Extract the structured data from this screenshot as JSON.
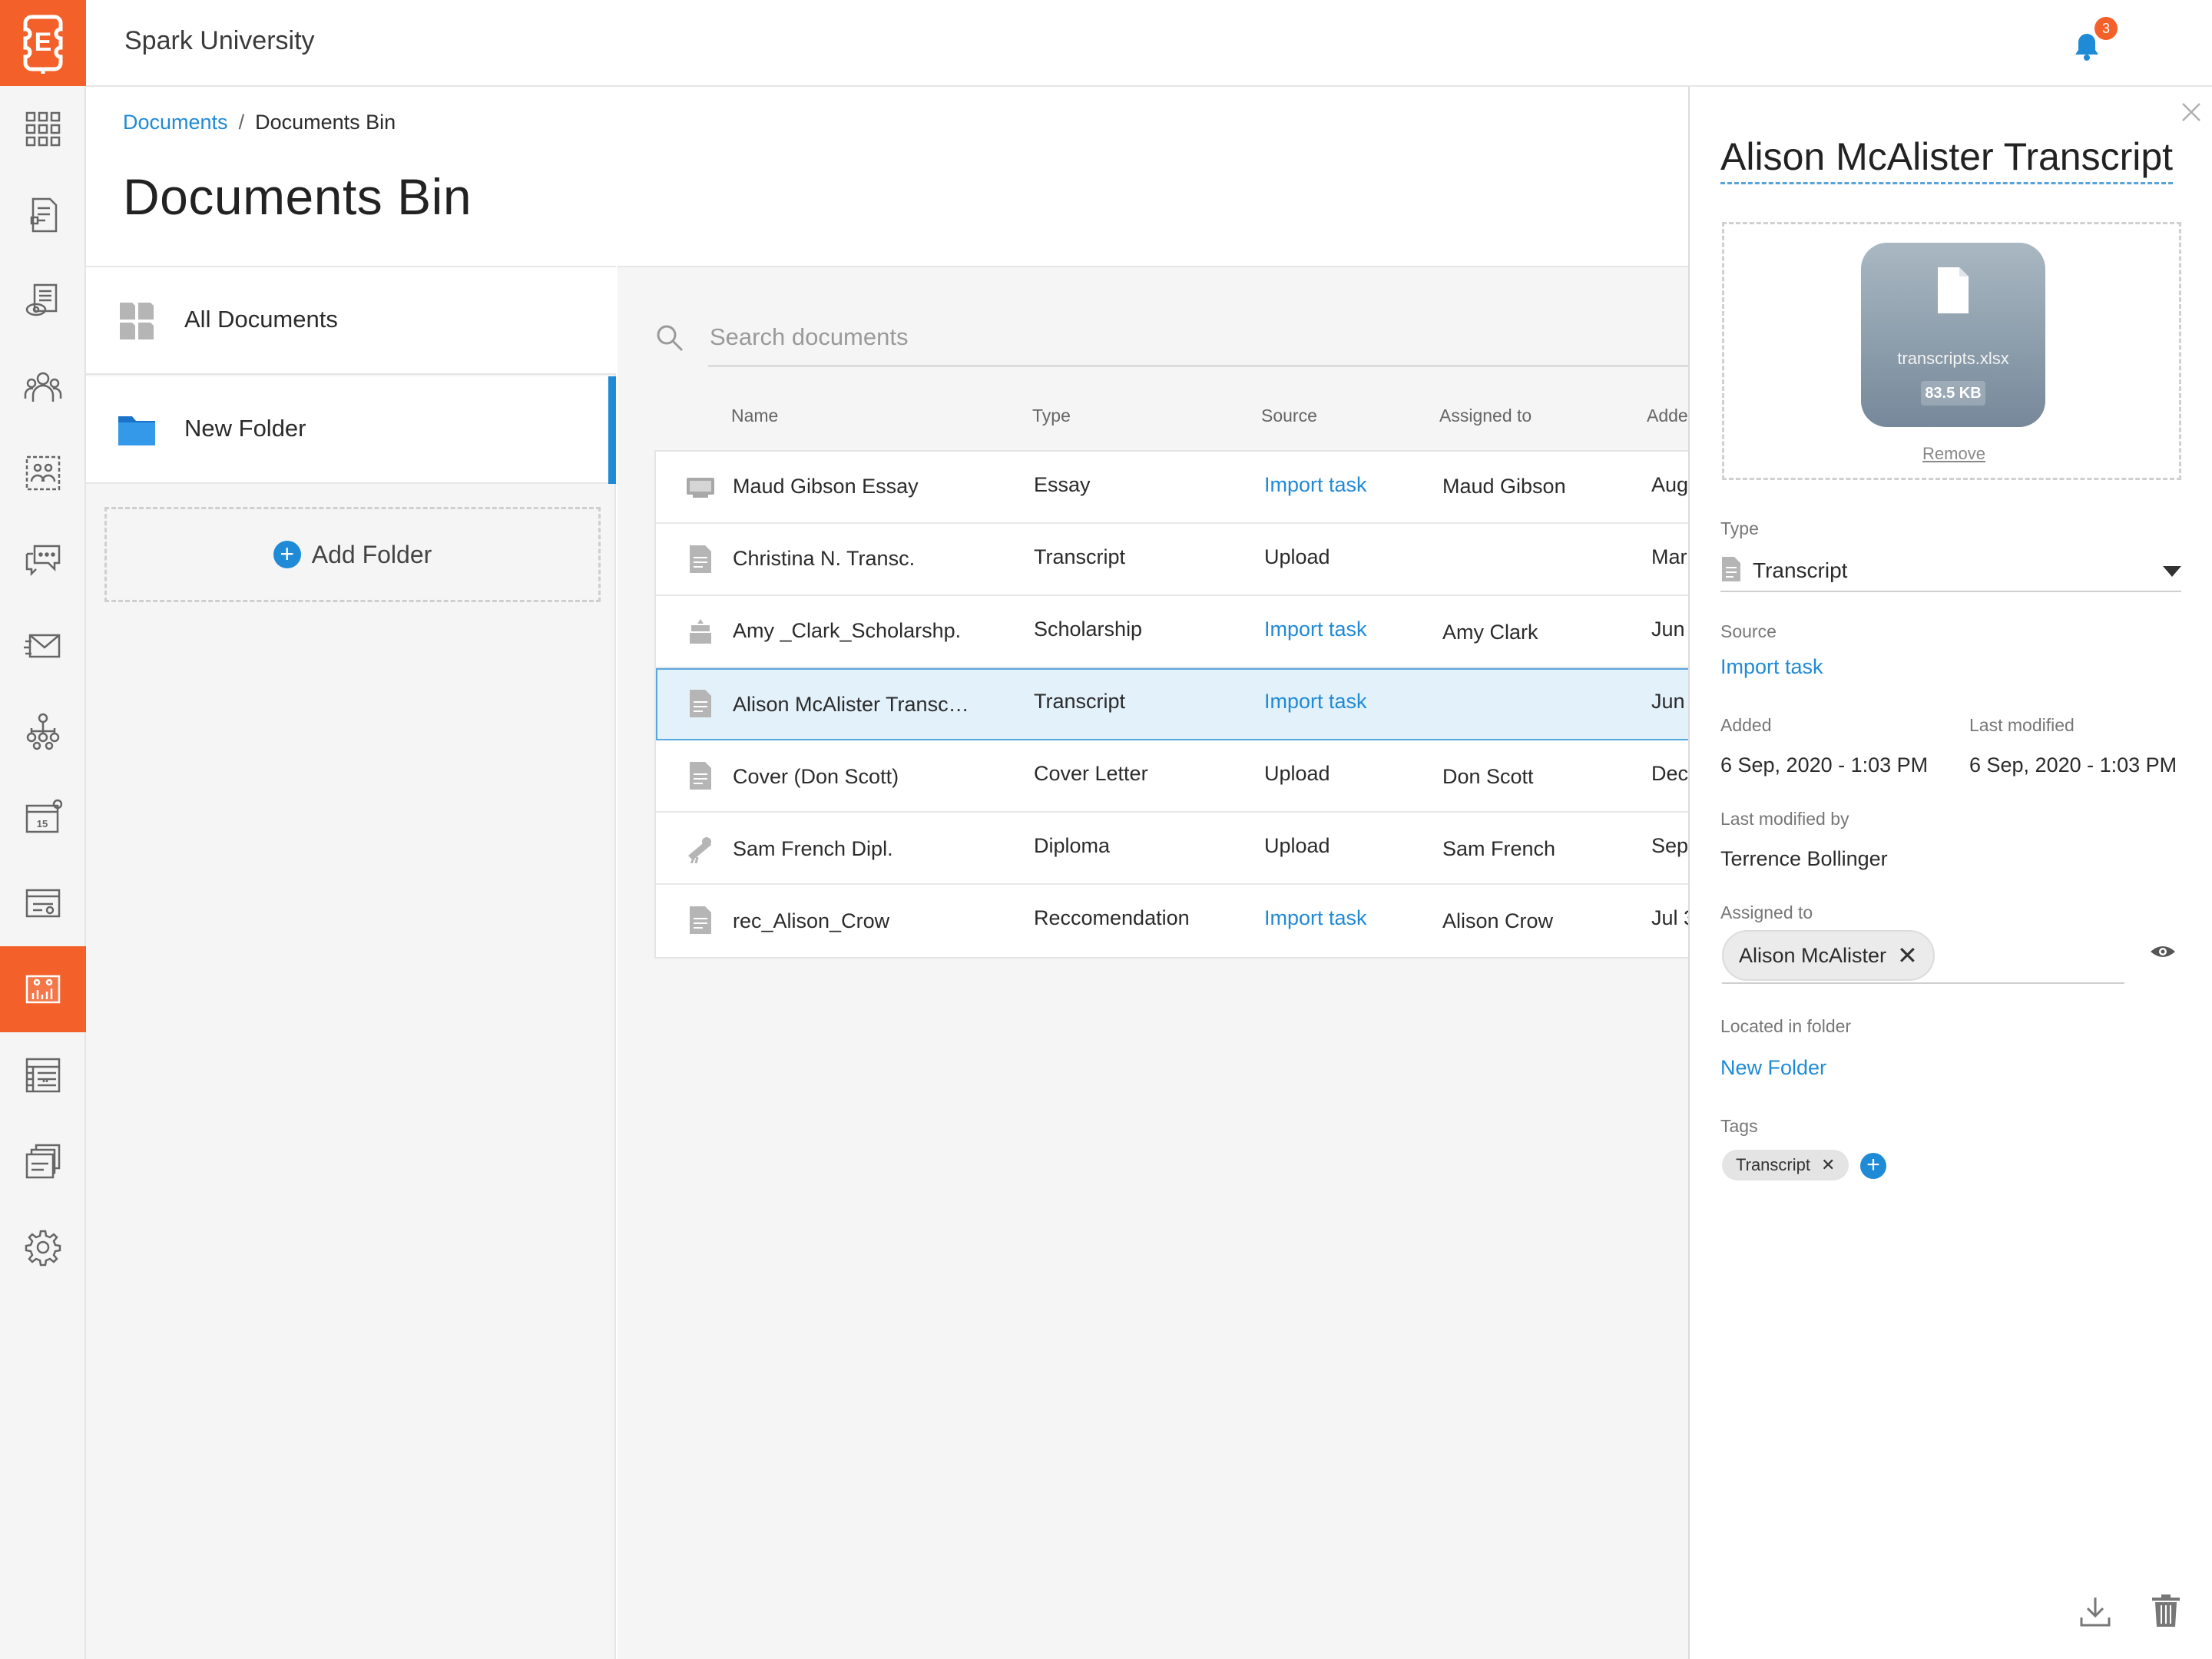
{
  "app": {
    "org_name": "Spark University",
    "notification_count": "3",
    "logo_letter": "E"
  },
  "nav": {
    "items": [
      "dashboard-icon",
      "forms-icon",
      "review-icon",
      "contacts-icon",
      "groups-icon",
      "messages-icon",
      "email-icon",
      "workflow-icon",
      "calendar-icon",
      "payments-icon",
      "documents-icon",
      "reports-icon",
      "files-icon",
      "settings-icon"
    ],
    "active": "documents-icon",
    "calendar_day": "15"
  },
  "breadcrumb": {
    "parent": "Documents",
    "separator": "/",
    "current": "Documents Bin"
  },
  "page": {
    "title": "Documents Bin"
  },
  "folders": {
    "items": [
      {
        "label": "All Documents",
        "icon": "all-documents-icon"
      },
      {
        "label": "New Folder",
        "icon": "folder-icon",
        "selected": true
      }
    ],
    "add_label": "Add Folder"
  },
  "search": {
    "placeholder": "Search documents",
    "value": ""
  },
  "table": {
    "columns": [
      "Name",
      "Type",
      "Source",
      "Assigned to",
      "Adde"
    ],
    "rows": [
      {
        "icon": "essay-icon",
        "name": "Maud Gibson Essay",
        "type": "Essay",
        "source": "Import task",
        "source_link": true,
        "assigned": "Maud Gibson",
        "added": "Aug"
      },
      {
        "icon": "document-icon",
        "name": "Christina N. Transc.",
        "type": "Transcript",
        "source": "Upload",
        "source_link": false,
        "assigned": "",
        "added": "Mar"
      },
      {
        "icon": "scholarship-icon",
        "name": "Amy _Clark_Scholarshp.",
        "type": "Scholarship",
        "source": "Import task",
        "source_link": true,
        "assigned": "Amy Clark",
        "added": "Jun"
      },
      {
        "icon": "document-icon",
        "name": "Alison McAlister Transc…",
        "type": "Transcript",
        "source": "Import task",
        "source_link": true,
        "assigned": "",
        "added": "Jun",
        "selected": true
      },
      {
        "icon": "document-icon",
        "name": "Cover (Don Scott)",
        "type": "Cover Letter",
        "source": "Upload",
        "source_link": false,
        "assigned": "Don Scott",
        "added": "Dec"
      },
      {
        "icon": "diploma-icon",
        "name": "Sam French Dipl.",
        "type": "Diploma",
        "source": "Upload",
        "source_link": false,
        "assigned": "Sam French",
        "added": "Sep"
      },
      {
        "icon": "document-icon",
        "name": "rec_Alison_Crow",
        "type": "Reccomendation",
        "source": "Import task",
        "source_link": true,
        "assigned": "Alison Crow",
        "added": "Jul 3"
      }
    ]
  },
  "detail": {
    "title": "Alison McAlister Transcript",
    "file_name": "transcripts.xlsx",
    "file_size": "83.5 KB",
    "remove_label": "Remove",
    "type_label": "Type",
    "type_value": "Transcript",
    "source_label": "Source",
    "source_value": "Import task",
    "added_label": "Added",
    "added_value": "6 Sep, 2020 - 1:03 PM",
    "modified_label": "Last modified",
    "modified_value": "6 Sep, 2020 - 1:03 PM",
    "modified_by_label": "Last modified by",
    "modified_by_value": "Terrence Bollinger",
    "assigned_label": "Assigned to",
    "assigned_value": "Alison McAlister",
    "folder_label": "Located in folder",
    "folder_value": "New Folder",
    "tags_label": "Tags",
    "tags": [
      "Transcript"
    ]
  },
  "colors": {
    "brand": "#f4602a",
    "accent": "#1f8ad6",
    "selected_row": "#e3f1fb"
  }
}
